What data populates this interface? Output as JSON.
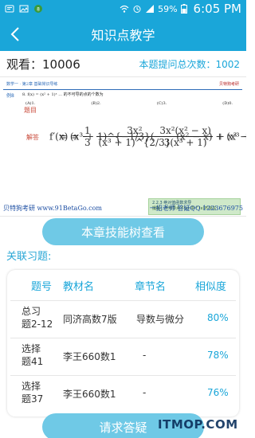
{
  "status_bar": {
    "battery": "59%",
    "time": "6:05 PM"
  },
  "header": {
    "title": "知识点教学"
  },
  "stats": {
    "views_label": "观看：",
    "views_value": "10006",
    "asked_label": "本题提问总次数：",
    "asked_value": "1002"
  },
  "doc": {
    "header_left": "数学一 · 第2章 基础常识导练",
    "header_right": "贝特狗考研",
    "exercise_tag": "例8",
    "question_text": "8. f(x) = (x² + 1)ˣ ... 的不可导的点的个数为",
    "choices": [
      "(A)1.",
      "(B)2.",
      "(C)3.",
      "(D)0."
    ],
    "q_label": "题目",
    "a_label": "解答",
    "formula_lead_1": "f′(x) = ",
    "formula_frac1_num": "1",
    "formula_frac1_den": "3",
    "formula_frac2_num": "3x²",
    "formula_frac2_den": "(x³ + 1)^{2/3}",
    "formula_tail_1": "(x² − x) + (x³ + 1)^{1/3}(3x² − 1)",
    "formula_row2_lead": "= (x³ + 1)^{−1/3}(",
    "formula_frac3_num": "3x²(x² − x)",
    "formula_frac3_den": "3(x³ + 1)",
    "formula_row2_tail": "+ x³ − 1)",
    "green_line1": "2.2.3 绝对值函数求导",
    "green_line2": "提醒：不可导点 f′(x) 中 f′′(x)不存在",
    "footer_left": "贝特狗考研 www.91BetaGo.com",
    "footer_right": "一招老师 答疑QQ 1223676975"
  },
  "buttons": {
    "tree": "本章技能树查看",
    "ask": "请求答疑"
  },
  "related": {
    "title": "关联习题:",
    "headers": [
      "题号",
      "教材名",
      "章节名",
      "相似度"
    ],
    "rows": [
      {
        "id_l1": "总习",
        "id_l2": "题2-12",
        "book": "同济高数7版",
        "chapter": "导数与微分",
        "sim": "80%"
      },
      {
        "id_l1": "选择",
        "id_l2": "题41",
        "book": "李王660数1",
        "chapter": "-",
        "sim": "78%"
      },
      {
        "id_l1": "选择",
        "id_l2": "题37",
        "book": "李王660数1",
        "chapter": "-",
        "sim": "76%"
      }
    ]
  },
  "watermark": "ITMOP.COM",
  "colors": {
    "brand": "#1aa6d9",
    "button": "#6fc9e6",
    "accent_red": "#c94a3a"
  }
}
